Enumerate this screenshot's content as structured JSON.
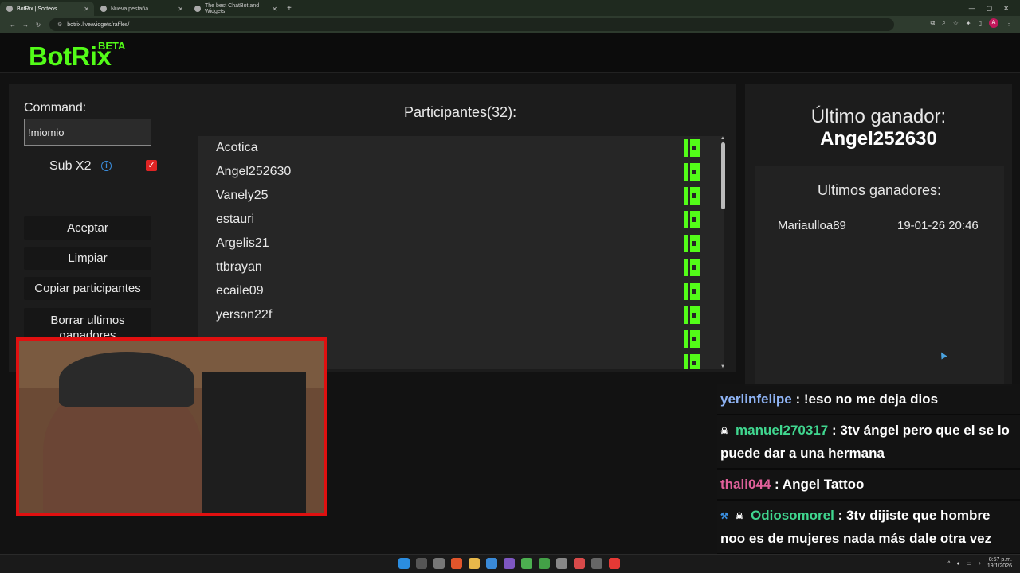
{
  "browser": {
    "tabs": [
      {
        "label": "BotRix | Sorteos",
        "active": true
      },
      {
        "label": "Nueva pestaña",
        "active": false
      },
      {
        "label": "The best ChatBot and Widgets",
        "active": false
      }
    ],
    "new_tab": "+",
    "url": "botrix.live/widgets/raffles/",
    "profile_initial": "A"
  },
  "header": {
    "logo": "BotRix",
    "beta": "BETA"
  },
  "controls": {
    "command_label": "Command:",
    "command_value": "!miomio",
    "sub_label": "Sub X2",
    "sub_checked": true,
    "accept_label": "Aceptar",
    "clear_label": "Limpiar",
    "copy_label": "Copiar participantes",
    "delete_label": "Borrar ultimos ganadores"
  },
  "participants": {
    "title": "Participantes(32):",
    "items": [
      "Acotica",
      "Angel252630",
      "Vanely25",
      "estauri",
      "Argelis21",
      "ttbrayan",
      "ecaile09",
      "yerson22f",
      ""
    ]
  },
  "winner": {
    "last_label": "Último ganador:",
    "last_name": "Angel252630",
    "list_title": "Ultimos ganadores:",
    "list": [
      {
        "name": "Mariaulloa89",
        "date": "19-01-26 20:46"
      }
    ]
  },
  "chat": [
    {
      "user": "yerlinfelipe",
      "color": "#8fb4f5",
      "badges": [],
      "text": " : !eso no me deja dios"
    },
    {
      "user": "manuel270317",
      "color": "#40d68f",
      "badges": [
        "skull"
      ],
      "text": " : 3tv ángel pero que el se lo puede dar a una hermana"
    },
    {
      "user": "thali044",
      "color": "#e0609a",
      "badges": [],
      "text": " : Angel Tattoo"
    },
    {
      "user": "Odiosomorel",
      "color": "#40d68f",
      "badges": [
        "pin",
        "skull"
      ],
      "text": " : 3tv dijiste que hombre noo es de mujeres nada más dale otra vez"
    }
  ],
  "taskbar": {
    "time": "8:57 p.m.",
    "date": "19/1/2026"
  },
  "colors": {
    "accent": "#53fc18",
    "danger": "#e02424",
    "info": "#3b8fe0"
  }
}
